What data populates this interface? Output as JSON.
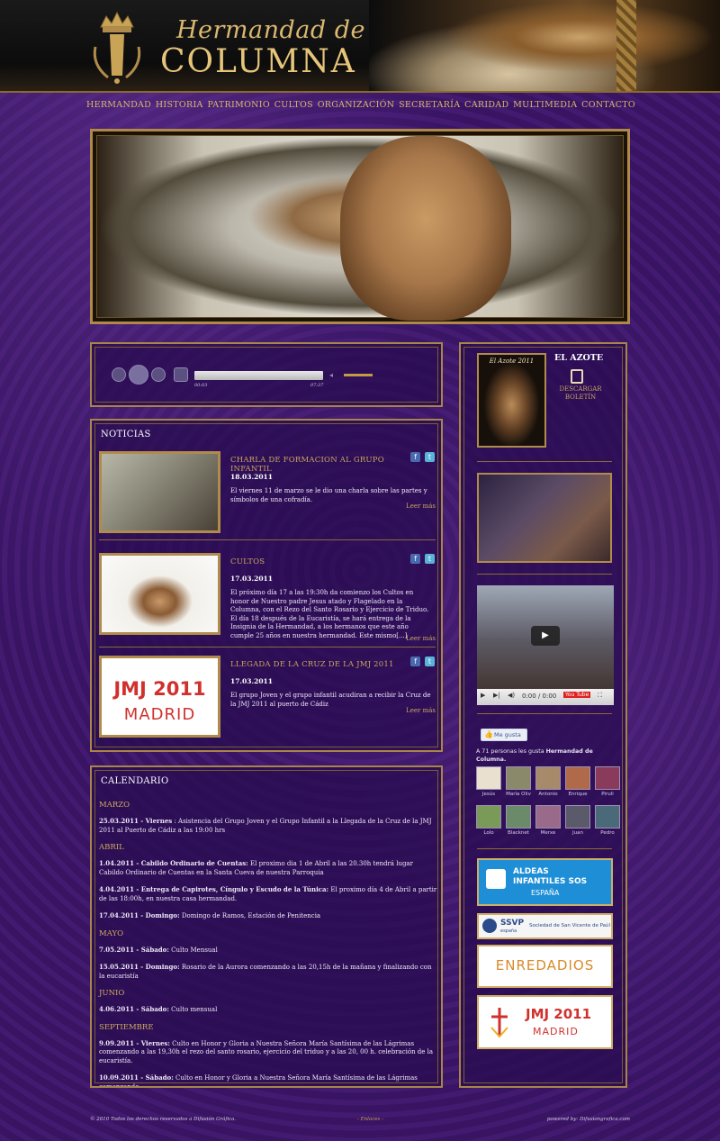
{
  "header": {
    "logo_line1": "Hermandad de",
    "logo_line2": "COLUMNA"
  },
  "nav": [
    "HERMANDAD",
    "HISTORIA",
    "PATRIMONIO",
    "CULTOS",
    "ORGANIZACIÓN",
    "SECRETARÍA",
    "CARIDAD",
    "MULTIMEDIA",
    "CONTACTO"
  ],
  "player": {
    "current_time": "00:03",
    "total_time": "07:37",
    "progress": 0.01,
    "volume": 0.8
  },
  "news": {
    "title": "NOTICIAS",
    "items": [
      {
        "title": "CHARLA DE FORMACION AL GRUPO INFANTIL",
        "date": "18.03.2011",
        "text": "El viernes 11 de marzo se le dio una charla sobre las partes y símbolos de una cofradía.",
        "more": "Leer más"
      },
      {
        "title": "CULTOS",
        "date": "17.03.2011",
        "text": "El próximo día 17 a las 19:30h da comienzo los Cultos en honor de Nuestro padre Jesus atado y Flagelado en la Columna,  con el Rezo del Santo Rosario y Ejercicio de Triduo. El día 18 después de la Eucaristía, se hará entrega de la Insignia de la Hermandad, a los hermanos que este año cumple 25 años en nuestra hermandad. Este mismo[...]",
        "more": "Leer más"
      },
      {
        "title": "LLEGADA DE LA CRUZ DE LA JMJ 2011",
        "date": "17.03.2011",
        "text": "El grupo Joven y el grupo infantil acudiran a recibir la Cruz de la JMJ 2011 al puerto de Cádiz",
        "more": "Leer más",
        "thumb_line1": "JMJ 2011",
        "thumb_line2": "MADRID"
      }
    ]
  },
  "calendar": {
    "title": "CALENDARIO",
    "months": [
      {
        "name": "MARZO",
        "entries": [
          {
            "head": "25.03.2011 - Viernes",
            "body": " : Asistencia del Grupo Joven y el Grupo Infantil a la Llegada de la Cruz de la JMJ 2011 al Puerto de Cádiz a las 19:00 hrs"
          }
        ]
      },
      {
        "name": "ABRIL",
        "entries": [
          {
            "head": "1.04.2011 - Cabildo Ordinario de Cuentas:",
            "body": " El proximo dia 1 de Abril a las 20.30h tendrá lugar Cabildo Ordinario de Cuentas en la Santa Cueva de nuestra Parroquia"
          },
          {
            "head": "4.04.2011 - Entrega de Capirotes, Cíngulo y Escudo de la Túnica:",
            "body": " El proximo día 4 de Abril a partir de las 18:00h, en nuestra casa hermandad."
          },
          {
            "head": "17.04.2011 - Domingo:",
            "body": " Domingo de Ramos, Estación de Penitencia"
          }
        ]
      },
      {
        "name": "MAYO",
        "entries": [
          {
            "head": "7.05.2011 - Sábado:",
            "body": " Culto Mensual"
          },
          {
            "head": "15.05.2011 - Domingo:",
            "body": " Rosario de la Aurora comenzando a las 20,15h de la mañana y finalizando con la eucaristía"
          }
        ]
      },
      {
        "name": "JUNIO",
        "entries": [
          {
            "head": "4.06.2011 - Sábado:",
            "body": " Culto mensual"
          }
        ]
      },
      {
        "name": "SEPTIEMBRE",
        "entries": [
          {
            "head": "9.09.2011 - Viernes:",
            "body": " Culto en Honor y Gloria a Nuestra Señora María Santísima de las Lágrimas comenzando a las 19,30h el rezo del santo rosario, ejercicio del triduo y a las 20, 00 h. celebración de la eucaristía."
          },
          {
            "head": "10.09.2011 - Sábado:",
            "body": " Culto en Honor y Gloria a Nuestra Señora María Santísima de las Lágrimas comenzando"
          }
        ]
      }
    ]
  },
  "sidebar": {
    "azote_cover_title": "El Azote 2011",
    "azote_title": "EL AZOTE",
    "download_label_1": "DESCARGAR",
    "download_label_2": "BOLETÍN",
    "video_time": "0:00 / 0:00",
    "youtube_label": "You Tube",
    "fb_like": "Me gusta",
    "fb_count_prefix": "A 71 personas les gusta ",
    "fb_page_name": "Hermandad de Columna.",
    "fans": [
      "Jesús",
      "María Oliv",
      "Antonio",
      "Enrique",
      "Piruli",
      "Lolo",
      "Blacknet",
      "Merxe",
      "Juan",
      "Pedro"
    ],
    "ad_sos_line1": "ALDEAS",
    "ad_sos_line2": "INFANTILES SOS",
    "ad_sos_line3": "ESPAÑA",
    "ad_ssvp_abbr": "SSVP",
    "ad_ssvp_sub": "españa",
    "ad_ssvp_full": "Sociedad de San Vicente de Paúl",
    "ad_ent": "ENREDADIOS",
    "ad_jmj_line1": "JMJ 2011",
    "ad_jmj_line2": "MADRID"
  },
  "footer": {
    "copyright": "© 2010 Todos los derechos reservados a Difusión Gráfica.",
    "links": "- Enlaces -",
    "powered": "powered by: Difusiongrafica.com"
  },
  "colors": {
    "gold": "#c8a55e",
    "purple_bg": "#3a1566",
    "panel_border": "#a88548"
  }
}
